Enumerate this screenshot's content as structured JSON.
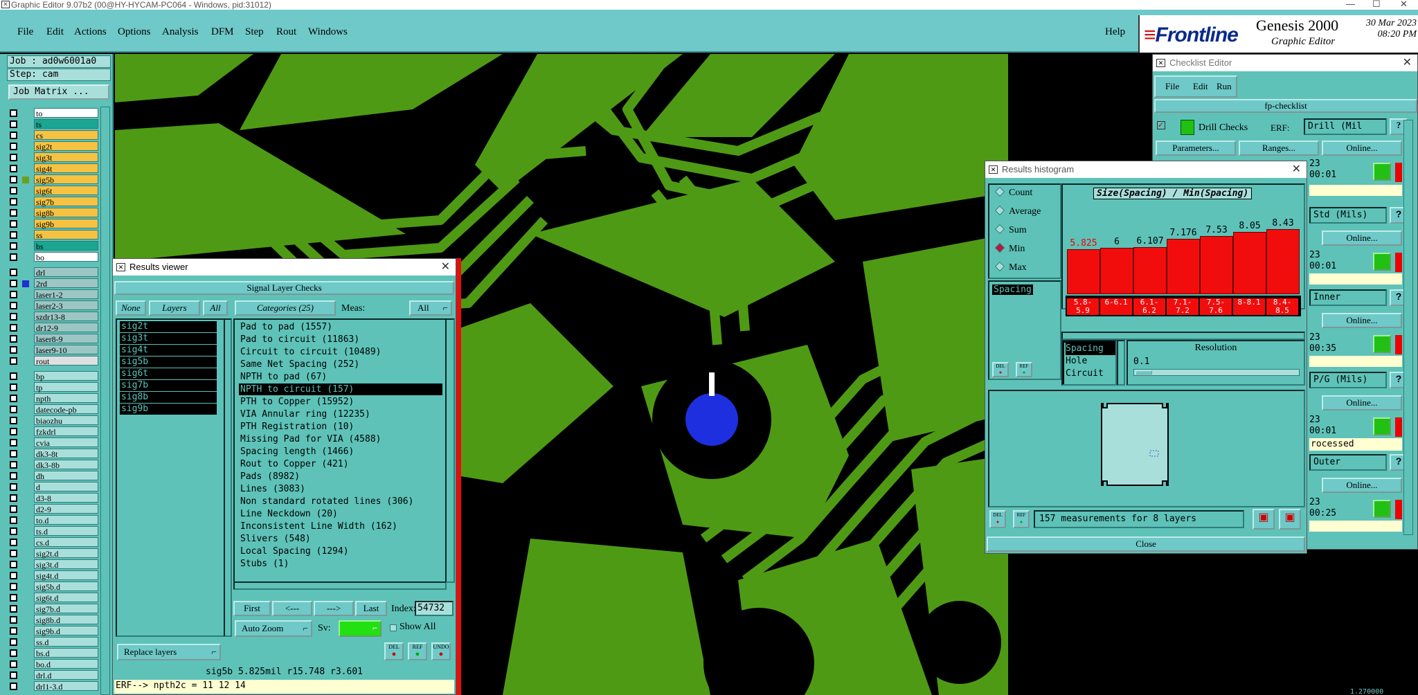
{
  "window": {
    "title": "Graphic Editor 9.07b2 (00@HY-HYCAM-PC064 - Windows, pid:31012)"
  },
  "menubar": {
    "items": [
      "File",
      "Edit",
      "Actions",
      "Options",
      "Analysis",
      "DFM",
      "Step",
      "Rout",
      "Windows"
    ],
    "help": "Help"
  },
  "brand": {
    "logo": "Frontline",
    "product": "Genesis 2000",
    "subtitle": "Graphic Editor",
    "date": "30 Mar 2023",
    "time": "08:20 PM"
  },
  "left_panel": {
    "job": "Job : ad0w6001a0",
    "step": "Step: cam",
    "job_matrix": "Job Matrix ...",
    "layers": [
      {
        "name": "to",
        "color": "#ffffff"
      },
      {
        "name": "ts",
        "color": "#1aa690"
      },
      {
        "name": "cs",
        "color": "#f5c242"
      },
      {
        "name": "sig2t",
        "color": "#f5c242"
      },
      {
        "name": "sig3t",
        "color": "#f5c242"
      },
      {
        "name": "sig4t",
        "color": "#f5c242"
      },
      {
        "name": "sig5b",
        "color": "#f5c242",
        "mark": "#6aa020"
      },
      {
        "name": "sig6t",
        "color": "#f5c242"
      },
      {
        "name": "sig7b",
        "color": "#f5c242"
      },
      {
        "name": "sig8b",
        "color": "#f5c242"
      },
      {
        "name": "sig9b",
        "color": "#f5c242"
      },
      {
        "name": "ss",
        "color": "#f5c242"
      },
      {
        "name": "bs",
        "color": "#1aa690"
      },
      {
        "name": "bo",
        "color": "#ffffff"
      },
      {
        "name": "drl",
        "color": "#9cc6c4",
        "gap": true
      },
      {
        "name": "2rd",
        "color": "#9cc6c4",
        "mark": "#1f2fd0"
      },
      {
        "name": "laser1-2",
        "color": "#9cc6c4"
      },
      {
        "name": "laser2-3",
        "color": "#9cc6c4"
      },
      {
        "name": "szdr13-8",
        "color": "#9cc6c4"
      },
      {
        "name": "dr12-9",
        "color": "#9cc6c4"
      },
      {
        "name": "laser8-9",
        "color": "#9cc6c4"
      },
      {
        "name": "laser9-10",
        "color": "#9cc6c4"
      },
      {
        "name": "rout",
        "color": "#e0e0e0"
      },
      {
        "name": "bp",
        "color": "#a9dfdb",
        "gap": true
      },
      {
        "name": "tp",
        "color": "#a9dfdb"
      },
      {
        "name": "npth",
        "color": "#a9dfdb"
      },
      {
        "name": "datecode-pb",
        "color": "#a9dfdb"
      },
      {
        "name": "biaozhu",
        "color": "#a9dfdb"
      },
      {
        "name": "fzkdrl",
        "color": "#a9dfdb"
      },
      {
        "name": "cvia",
        "color": "#a9dfdb"
      },
      {
        "name": "dk3-8t",
        "color": "#a9dfdb"
      },
      {
        "name": "dk3-8b",
        "color": "#a9dfdb"
      },
      {
        "name": "dh",
        "color": "#a9dfdb"
      },
      {
        "name": "d",
        "color": "#a9dfdb"
      },
      {
        "name": "d3-8",
        "color": "#a9dfdb"
      },
      {
        "name": "d2-9",
        "color": "#a9dfdb"
      },
      {
        "name": "to.d",
        "color": "#a9dfdb"
      },
      {
        "name": "ts.d",
        "color": "#a9dfdb"
      },
      {
        "name": "cs.d",
        "color": "#a9dfdb"
      },
      {
        "name": "sig2t.d",
        "color": "#a9dfdb"
      },
      {
        "name": "sig3t.d",
        "color": "#a9dfdb"
      },
      {
        "name": "sig4t.d",
        "color": "#a9dfdb"
      },
      {
        "name": "sig5b.d",
        "color": "#a9dfdb"
      },
      {
        "name": "sig6t.d",
        "color": "#a9dfdb"
      },
      {
        "name": "sig7b.d",
        "color": "#a9dfdb"
      },
      {
        "name": "sig8b.d",
        "color": "#a9dfdb"
      },
      {
        "name": "sig9b.d",
        "color": "#a9dfdb"
      },
      {
        "name": "ss.d",
        "color": "#a9dfdb"
      },
      {
        "name": "bs.d",
        "color": "#a9dfdb"
      },
      {
        "name": "bo.d",
        "color": "#a9dfdb"
      },
      {
        "name": "drl.d",
        "color": "#a9dfdb"
      },
      {
        "name": "drl1-3.d",
        "color": "#a9dfdb"
      }
    ]
  },
  "results_viewer": {
    "title": "Results viewer",
    "header": "Signal Layer Checks",
    "none": "None",
    "layers_label": "Layers",
    "all": "All",
    "categories_label": "Categories (25)",
    "meas_label": "Meas:",
    "meas_value": "All",
    "layers": [
      "sig2t",
      "sig3t",
      "sig4t",
      "sig5b",
      "sig6t",
      "sig7b",
      "sig8b",
      "sig9b"
    ],
    "categories": [
      "Pad to pad (1557)",
      "Pad to circuit (11863)",
      "Circuit to circuit (10489)",
      "Same Net Spacing (252)",
      "NPTH to pad (67)",
      "NPTH to circuit (157)",
      "PTH to Copper (15952)",
      "VIA Annular ring (12235)",
      "PTH Registration (10)",
      "Missing Pad for VIA (4588)",
      "Spacing length (1466)",
      "Rout to Copper (421)",
      "Pads (8982)",
      "Lines (3083)",
      "Non standard rotated lines (306)",
      "Line Neckdown (20)",
      "Inconsistent Line Width (162)",
      "Slivers (548)",
      "Local Spacing (1294)",
      "Stubs (1)"
    ],
    "selected_category": 5,
    "first": "First",
    "prev": "<---",
    "next": "--->",
    "last": "Last",
    "index_label": "Index:",
    "index_value": "54732",
    "auto_zoom": "Auto Zoom",
    "sv_label": "Sv:",
    "show_all": "Show All",
    "replace_layers": "Replace layers",
    "status": "sig5b  5.825mil  r15.748  r3.601",
    "erf": "ERF--> npth2c = 11 12 14",
    "del": "DEL",
    "ref": "REF",
    "undo": "UNDO"
  },
  "histogram": {
    "title": "Results histogram",
    "modes": [
      "Count",
      "Average",
      "Sum",
      "Min",
      "Max"
    ],
    "selected_mode": "Min",
    "chart_title": "Size(Spacing) / Min(Spacing)",
    "list_items": [
      "Spacing",
      "Hole",
      "Circuit"
    ],
    "list_top": "Spacing",
    "resolution_label": "Resolution",
    "resolution_value": "0.1",
    "measure_text": "157 measurements for 8 layers",
    "close": "Close"
  },
  "chart_data": {
    "type": "bar",
    "title": "Size(Spacing) / Min(Spacing)",
    "categories": [
      "5.8-5.9",
      "6-6.1",
      "6.1-6.2",
      "7.1-7.2",
      "7.5-7.6",
      "8-8.1",
      "8.4-8.5"
    ],
    "values": [
      5.825,
      6,
      6.107,
      7.176,
      7.53,
      8.05,
      8.43
    ],
    "value_labels": [
      "5.825",
      "6",
      "6.107",
      "7.176",
      "7.53",
      "8.05",
      "8.43"
    ],
    "ylim": [
      0,
      9
    ]
  },
  "checklist": {
    "title": "Checklist Editor",
    "menu": [
      "File",
      "Edit",
      "Run"
    ],
    "name": "fp-checklist",
    "first_check": "Drill Checks",
    "erf_label": "ERF:",
    "erf_value": "Drill (Mil",
    "parameters": "Parameters...",
    "ranges": "Ranges...",
    "online": "Online...",
    "rows": [
      {
        "field": "Std (Mils)",
        "time_a": "23",
        "time_b": "00:01"
      },
      {
        "field": "Inner",
        "time_a": "23",
        "time_b": "00:35"
      },
      {
        "field": "P/G (Mils)",
        "time_a": "23",
        "time_b": "00:01"
      },
      {
        "field": "Outer",
        "time_a": "23",
        "time_b": "00:25"
      }
    ],
    "first_time_a": "23",
    "first_time_b": "00:01",
    "processed": "rocessed",
    "bottom_readout": "1.270000"
  }
}
